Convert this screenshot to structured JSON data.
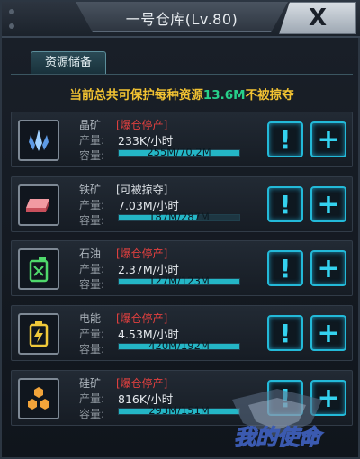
{
  "header": {
    "title": "一号仓库(Lv.80)",
    "close_label": "X"
  },
  "tabs": [
    {
      "label": "资源储备"
    }
  ],
  "notice": {
    "prefix": "当前总共可保护每种资源",
    "amount": "13.6M",
    "suffix": "不被掠夺"
  },
  "labels": {
    "production": "产量:",
    "capacity": "容量:"
  },
  "buttons": {
    "info": "!",
    "add": "+"
  },
  "resources": [
    {
      "name": "晶矿",
      "status": "[爆仓停产]",
      "status_color": "#e2403f",
      "production": "233K/小时",
      "capacity": "255M/70.2M",
      "fill": 1.0,
      "icon": "crystal-icon"
    },
    {
      "name": "铁矿",
      "status": "[可被掠夺]",
      "status_color": "#d9dee3",
      "production": "7.03M/小时",
      "capacity": "187M/287M",
      "fill": 0.65,
      "icon": "iron-ingot-icon"
    },
    {
      "name": "石油",
      "status": "[爆仓停产]",
      "status_color": "#e2403f",
      "production": "2.37M/小时",
      "capacity": "127M/123M",
      "fill": 1.0,
      "icon": "oil-can-icon"
    },
    {
      "name": "电能",
      "status": "[爆仓停产]",
      "status_color": "#e2403f",
      "production": "4.53M/小时",
      "capacity": "420M/192M",
      "fill": 1.0,
      "icon": "battery-icon"
    },
    {
      "name": "硅矿",
      "status": "[爆仓停产]",
      "status_color": "#e2403f",
      "production": "816K/小时",
      "capacity": "293M/151M",
      "fill": 1.0,
      "icon": "silicon-hexagon-icon"
    }
  ],
  "watermark": {
    "text": "我的使命"
  }
}
